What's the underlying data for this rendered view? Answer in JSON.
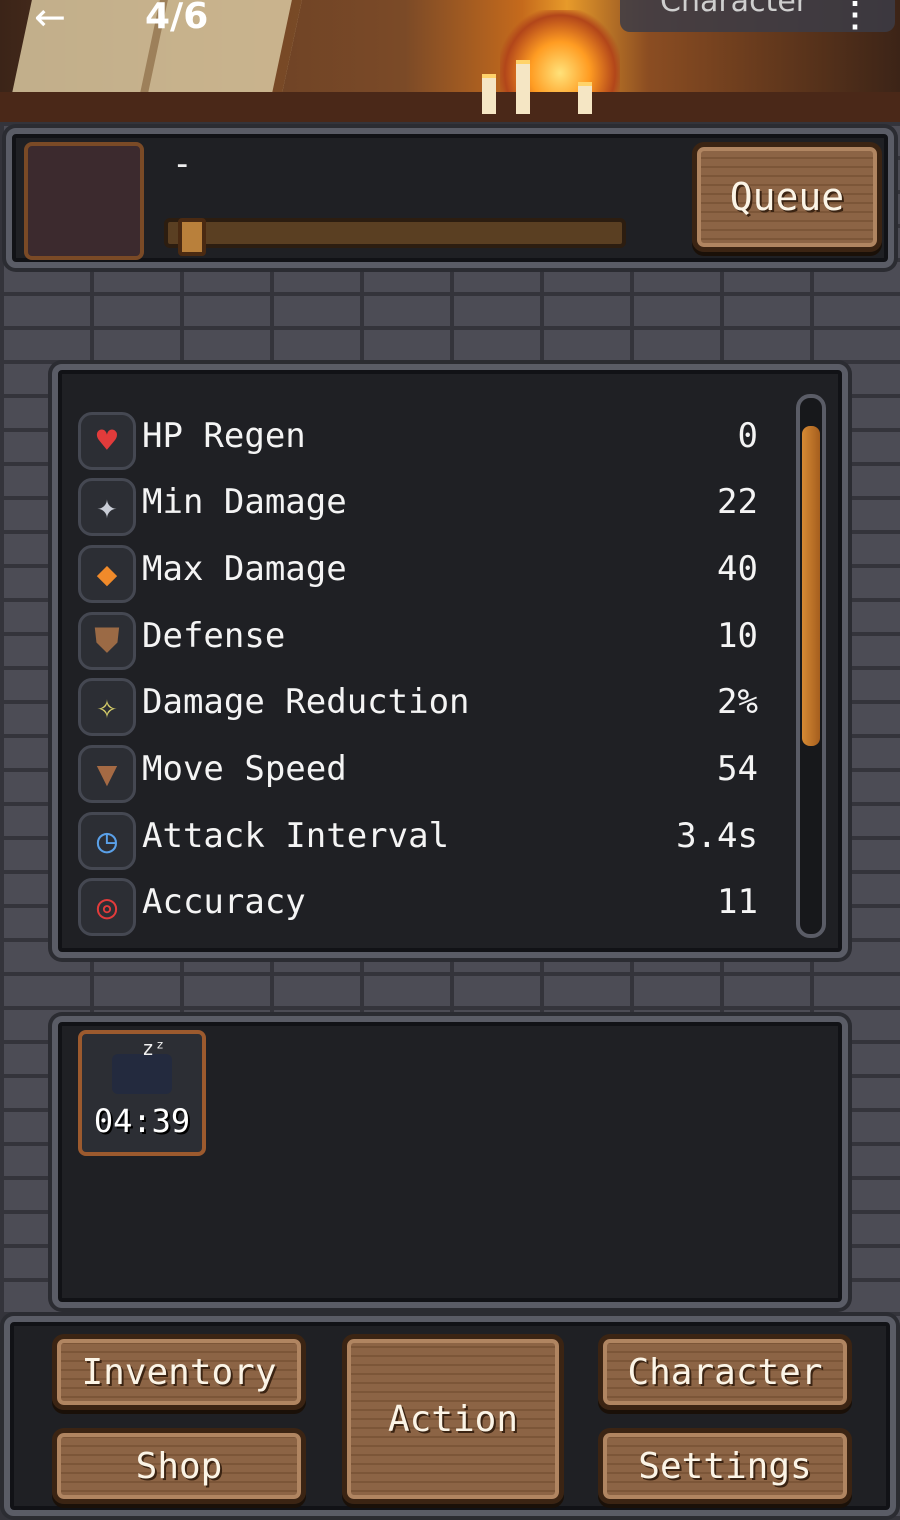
{
  "header": {
    "back_icon": "arrow-left-icon",
    "page_indicator": "4/6",
    "menu_title": "Character",
    "more_icon": "kebab-vertical-icon"
  },
  "action": {
    "name": "-",
    "progress": 0.0,
    "queue_label": "Queue"
  },
  "stats": [
    {
      "icon": "heart-plus-icon",
      "label": "HP Regen",
      "value": "0"
    },
    {
      "icon": "sword-icon",
      "label": "Min Damage",
      "value": "22"
    },
    {
      "icon": "flaming-sword-icon",
      "label": "Max Damage",
      "value": "40"
    },
    {
      "icon": "shield-icon",
      "label": "Defense",
      "value": "10"
    },
    {
      "icon": "sparkle-card-icon",
      "label": "Damage Reduction",
      "value": "2%"
    },
    {
      "icon": "boot-icon",
      "label": "Move Speed",
      "value": "54"
    },
    {
      "icon": "clock-sword-icon",
      "label": "Attack Interval",
      "value": "3.4s"
    },
    {
      "icon": "target-icon",
      "label": "Accuracy",
      "value": "11"
    }
  ],
  "buffs": [
    {
      "icon": "sleeping-icon",
      "timer": "04:39"
    }
  ],
  "nav": {
    "inventory": "Inventory",
    "shop": "Shop",
    "action": "Action",
    "character": "Character",
    "settings": "Settings"
  },
  "colors": {
    "panel_bg": "#1f2024",
    "panel_border": "#5a5c66",
    "wood": "#8c6445",
    "scroll_thumb": "#d68a34"
  }
}
